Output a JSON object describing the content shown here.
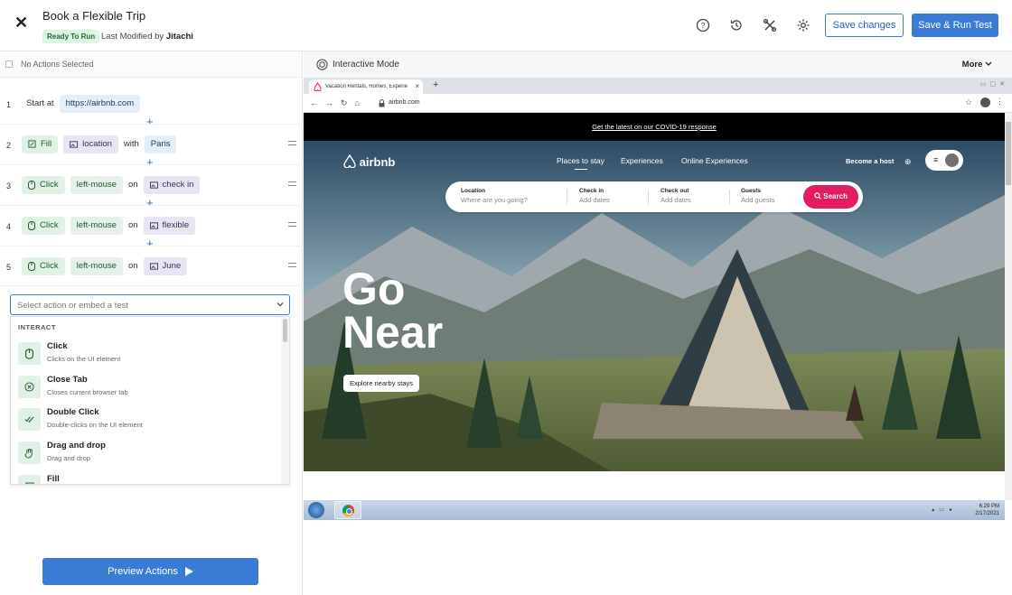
{
  "header": {
    "title": "Book a Flexible Trip",
    "status": "Ready To Run",
    "modified_prefix": "Last Modified by",
    "modified_by": "Jitachi",
    "save_label": "Save changes",
    "save_run_label": "Save & Run Test"
  },
  "actions_panel": {
    "selection_text": "No Actions Selected",
    "steps": [
      {
        "num": "1",
        "verb": "Start at",
        "url": "https://airbnb.com"
      },
      {
        "num": "2",
        "action": "Fill",
        "target": "location",
        "connector": "with",
        "value": "Paris"
      },
      {
        "num": "3",
        "action": "Click",
        "modifier": "left-mouse",
        "connector": "on",
        "target": "check in"
      },
      {
        "num": "4",
        "action": "Click",
        "modifier": "left-mouse",
        "connector": "on",
        "target": "flexible"
      },
      {
        "num": "5",
        "action": "Click",
        "modifier": "left-mouse",
        "connector": "on",
        "target": "June"
      }
    ],
    "select_placeholder": "Select action or embed a test",
    "dropdown": {
      "group": "INTERACT",
      "options": [
        {
          "title": "Click",
          "desc": "Clicks on the UI element",
          "icon": "mouse-icon"
        },
        {
          "title": "Close Tab",
          "desc": "Closes current browser tab",
          "icon": "close-circle-icon"
        },
        {
          "title": "Double Click",
          "desc": "Double-clicks on the UI element",
          "icon": "double-check-icon"
        },
        {
          "title": "Drag and drop",
          "desc": "Drag and drop",
          "icon": "hand-icon"
        },
        {
          "title": "Fill",
          "desc": "",
          "icon": "fill-icon"
        }
      ]
    },
    "preview_label": "Preview Actions"
  },
  "browser_panel": {
    "mode_label": "Interactive Mode",
    "more_label": "More",
    "tab_title": "Vacation Rentals, Homes, Experie",
    "address": "airbnb.com",
    "site": {
      "covid_banner": "Get the latest on our COVID-19 response",
      "brand": "airbnb",
      "nav": [
        "Places to stay",
        "Experiences",
        "Online Experiences"
      ],
      "become_host": "Become a host",
      "search_fields": [
        {
          "label": "Location",
          "value": "Where are you going?"
        },
        {
          "label": "Check in",
          "value": "Add dates"
        },
        {
          "label": "Check out",
          "value": "Add dates"
        },
        {
          "label": "Guests",
          "value": "Add guests"
        }
      ],
      "search_button": "Search",
      "hero_title_1": "Go",
      "hero_title_2": "Near",
      "explore_button": "Explore nearby stays"
    },
    "taskbar": {
      "time": "6:29 PM",
      "date": "2/17/2021"
    }
  },
  "colors": {
    "accent": "#3a7bd5",
    "ready_badge_bg": "#dff3e4",
    "airbnb_brand": "#e31c5f"
  }
}
